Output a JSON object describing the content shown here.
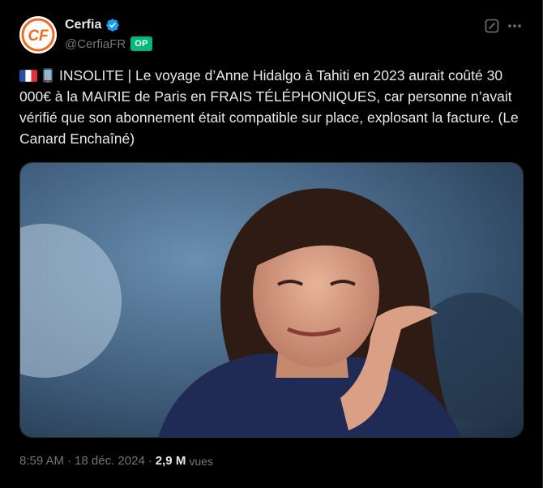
{
  "author": {
    "display_name": "Cerfia",
    "handle": "@CerfiaFR",
    "badge": "OP",
    "avatar_text": "CF",
    "verified_color": "#1d9bf0"
  },
  "tweet": {
    "text": "INSOLITE | Le voyage d’Anne Hidalgo à Tahiti en 2023 aurait coûté 30 000€ à la MAIRIE de Paris en FRAIS TÉLÉPHONIQUES, car personne n’avait vérifié que son abonnement était compatible sur place, explosant la facture. (Le Canard Enchaîné)",
    "emojis": [
      "flag-france-icon",
      "mobile-phone-icon"
    ]
  },
  "media": {
    "description_icon": "photo"
  },
  "meta": {
    "time": "8:59 AM",
    "separator": "·",
    "date": "18 déc. 2024",
    "views_count": "2,9 M",
    "views_label": "vues"
  },
  "colors": {
    "background": "#000000",
    "text": "#e7e9ea",
    "muted": "#71767b",
    "badge": "#00ba7c",
    "brand_orange": "#f26a21"
  }
}
